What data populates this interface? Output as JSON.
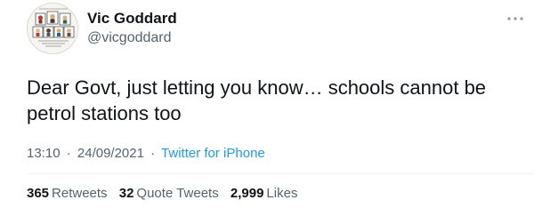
{
  "author": {
    "display_name": "Vic Goddard",
    "handle": "@vicgoddard"
  },
  "avatar": {
    "caption_top": "#UpForTheChallenge",
    "caption_bottom": "Letting teach our students not important stuff"
  },
  "tweet": {
    "text": "Dear Govt, just letting you know… schools cannot be petrol stations too",
    "time": "13:10",
    "separator": "·",
    "date": "24/09/2021",
    "source": "Twitter for iPhone"
  },
  "stats": {
    "retweets": {
      "count": "365",
      "label": "Retweets"
    },
    "quote_tweets": {
      "count": "32",
      "label": "Quote Tweets"
    },
    "likes": {
      "count": "2,999",
      "label": "Likes"
    }
  },
  "icons": {
    "more": "more-horizontal-icon"
  },
  "colors": {
    "text": "#0f1419",
    "secondary": "#536471",
    "link": "#1d9bf0",
    "divider": "#eff3f4"
  }
}
